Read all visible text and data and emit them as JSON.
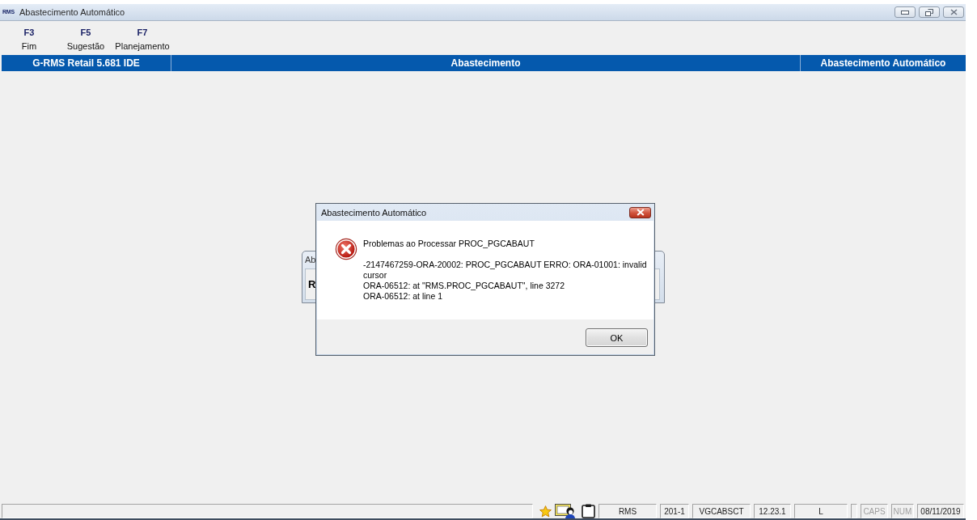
{
  "window": {
    "logo": "RMS",
    "title": "Abastecimento Automático"
  },
  "toolbar": [
    {
      "key": "F3",
      "label": "Fim"
    },
    {
      "key": "F5",
      "label": "Sugestão"
    },
    {
      "key": "F7",
      "label": "Planejamento"
    }
  ],
  "header": [
    "G-RMS Retail 5.681 IDE",
    "Abastecimento",
    "Abastecimento Automático"
  ],
  "background_window": {
    "title": "Ab",
    "text": "R"
  },
  "dialog": {
    "title": "Abastecimento Automático",
    "heading": "Problemas ao Processar PROC_PGCABAUT",
    "message": [
      "-2147467259-ORA-20002: PROC_PGCABAUT ERRO: ORA-01001: invalid cursor",
      "ORA-06512: at \"RMS.PROC_PGCABAUT\", line 3272",
      "ORA-06512: at line 1"
    ],
    "button": "OK"
  },
  "status_bar": {
    "fields": [
      "RMS",
      "201-1",
      "VGCABSCT",
      "12.23.1",
      "L"
    ],
    "indicators": [
      {
        "label": "CAPS",
        "on": false
      },
      {
        "label": "NUM",
        "on": false
      }
    ],
    "date": "08/11/2019"
  }
}
